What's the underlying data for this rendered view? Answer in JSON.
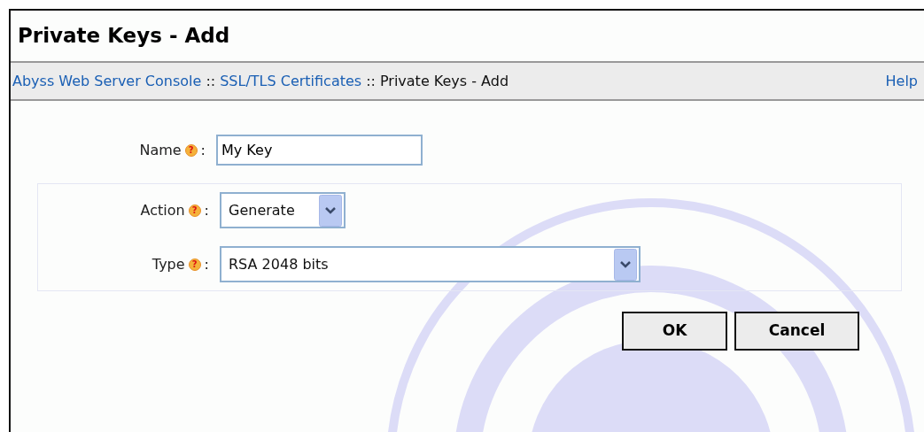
{
  "page_title": "Private Keys - Add",
  "breadcrumb": {
    "separator": "::",
    "items": [
      {
        "label": "Abyss Web Server Console",
        "kind": "link"
      },
      {
        "label": "SSL/TLS Certificates",
        "kind": "link"
      },
      {
        "label": "Private Keys - Add",
        "kind": "current"
      }
    ],
    "help": "Help"
  },
  "name_field": {
    "label": "Name",
    "help_mark": "?",
    "colon": ":",
    "value": "My Key"
  },
  "key_group": [
    {
      "label": "Action",
      "help_mark": "?",
      "colon": ":",
      "value": "Generate",
      "kind": "short"
    },
    {
      "label": "Type",
      "help_mark": "?",
      "colon": ":",
      "value": "RSA 2048 bits",
      "kind": "long"
    }
  ],
  "buttons": [
    "OK",
    "Cancel"
  ]
}
